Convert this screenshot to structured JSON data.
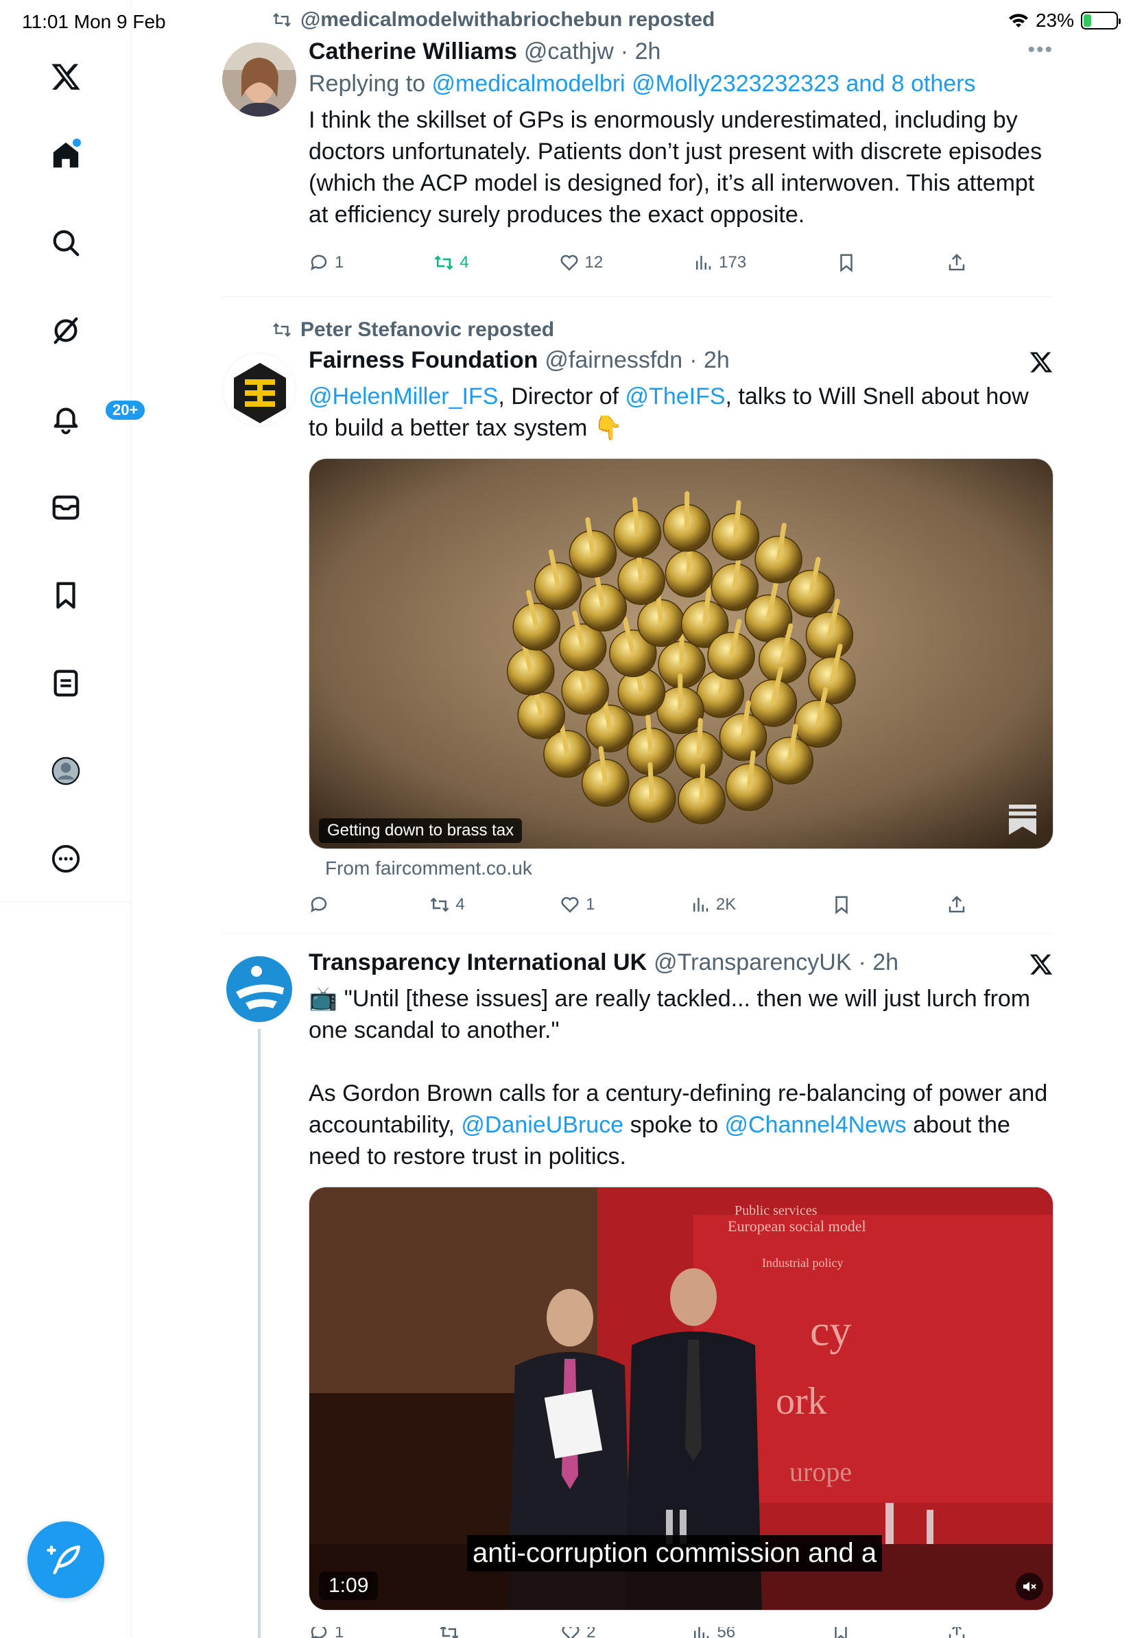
{
  "status": {
    "time_date": "11:01  Mon 9 Feb",
    "battery": "23%",
    "battery_level": 0.23
  },
  "sidebar": {
    "notifications_badge": "20+"
  },
  "tweets": [
    {
      "repost_label": "@medicalmodelwithabriochebun reposted",
      "name": "Catherine Williams",
      "handle": "@cathjw",
      "time": "· 2h",
      "replying_prefix": "Replying to ",
      "replying_to_1": "@medicalmodelbri",
      "replying_to_2": "@Molly2323232323",
      "replying_others": "and 8 others",
      "text": "I think the skillset of GPs is enormously underestimated, including by doctors unfortunately. Patients don’t just present with discrete episodes (which the ACP model is designed for), it’s all interwoven. This attempt at efficiency surely produces the exact opposite.",
      "replies": "1",
      "reposts": "4",
      "likes": "12",
      "views": "173"
    },
    {
      "repost_label": "Peter Stefanovic reposted",
      "name": "Fairness Foundation",
      "handle": "@fairnessfdn",
      "time": "· 2h",
      "text_mention_1": "@HelenMiller_IFS",
      "text_part_1": ", Director of ",
      "text_mention_2": "@TheIFS",
      "text_part_2": ", talks to Will Snell about how to build a better tax system 👇",
      "media_caption": "Getting down to brass tax",
      "from_site": "From faircomment.co.uk",
      "replies": "",
      "reposts": "4",
      "likes": "1",
      "views": "2K"
    },
    {
      "name": "Transparency International UK",
      "handle": "@TransparencyUK",
      "time": "· 2h",
      "text_line_1": "📺 \"Until [these issues] are really tackled... then we will just lurch from one scandal to another.\"",
      "text_line_2_a": "As Gordon Brown calls for a century-defining re-balancing of power and accountability, ",
      "text_mention_1": "@DanieUBruce",
      "text_line_2_b": " spoke to ",
      "text_mention_2": "@Channel4News",
      "text_line_2_c": " about the need to restore trust in politics.",
      "video_time": "1:09",
      "video_subtitle": "anti-corruption commission and a",
      "replies": "1",
      "reposts": "",
      "likes": "2",
      "views": "56"
    }
  ]
}
